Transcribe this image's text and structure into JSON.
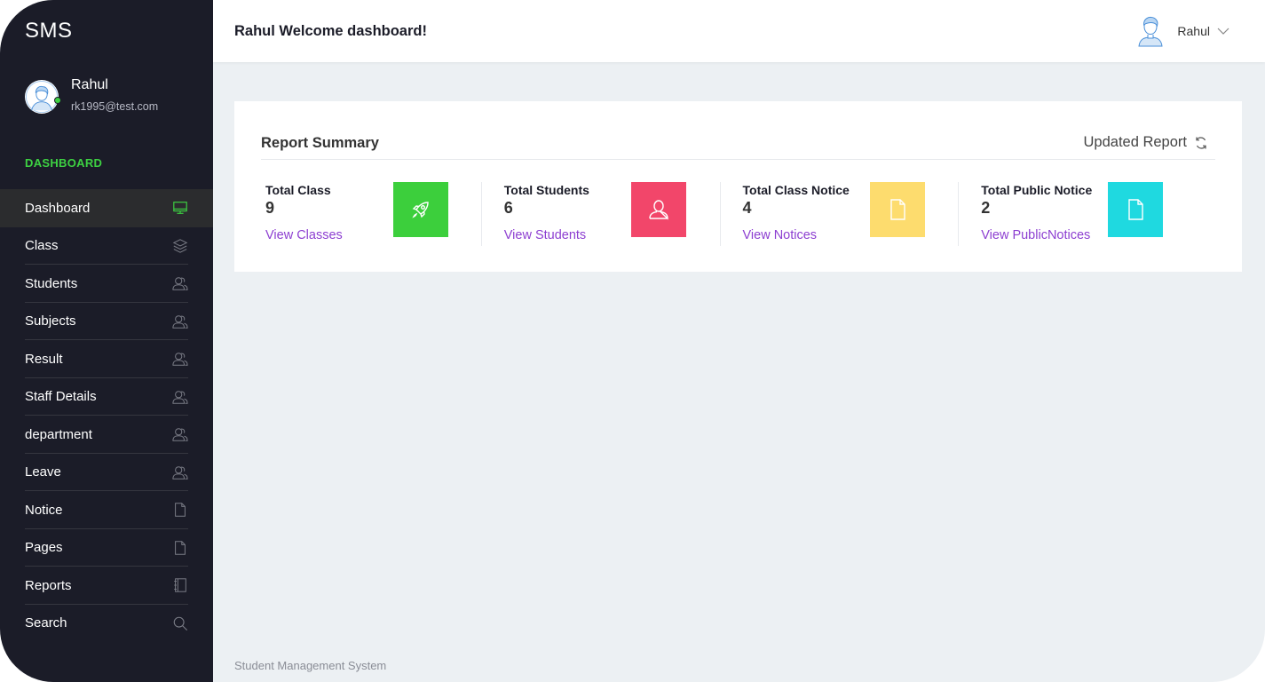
{
  "sidebar": {
    "brand": "SMS",
    "user": {
      "name": "Rahul",
      "email": "rk1995@test.com"
    },
    "section_label": "DASHBOARD",
    "items": [
      {
        "label": "Dashboard",
        "icon": "monitor-icon",
        "active": true
      },
      {
        "label": "Class",
        "icon": "layers-icon"
      },
      {
        "label": "Students",
        "icon": "users-icon"
      },
      {
        "label": "Subjects",
        "icon": "users-icon"
      },
      {
        "label": "Result",
        "icon": "users-icon"
      },
      {
        "label": "Staff Details",
        "icon": "users-icon"
      },
      {
        "label": "department",
        "icon": "users-icon"
      },
      {
        "label": "Leave",
        "icon": "users-icon"
      },
      {
        "label": "Notice",
        "icon": "file-icon"
      },
      {
        "label": "Pages",
        "icon": "file-icon"
      },
      {
        "label": "Reports",
        "icon": "notebook-icon"
      },
      {
        "label": "Search",
        "icon": "search-icon"
      }
    ]
  },
  "header": {
    "title": "Rahul Welcome dashboard!",
    "user_name": "Rahul"
  },
  "report": {
    "title": "Report Summary",
    "updated_label": "Updated Report",
    "stats": [
      {
        "label": "Total Class",
        "value": "9",
        "link": "View Classes",
        "color": "#3ccf3c",
        "icon": "rocket-icon"
      },
      {
        "label": "Total Students",
        "value": "6",
        "link": "View Students",
        "color": "#f2466a",
        "icon": "user-icon"
      },
      {
        "label": "Total Class Notice",
        "value": "4",
        "link": "View Notices",
        "color": "#fddc6e",
        "icon": "file-icon"
      },
      {
        "label": "Total Public Notice",
        "value": "2",
        "link": "View PublicNotices",
        "color": "#1fd9e0",
        "icon": "file-icon"
      }
    ]
  },
  "footer": {
    "text": "Student Management System"
  },
  "colors": {
    "sidebar_bg": "#1b1c28",
    "accent_green": "#3dd142",
    "link_purple": "#8d3fd1"
  }
}
